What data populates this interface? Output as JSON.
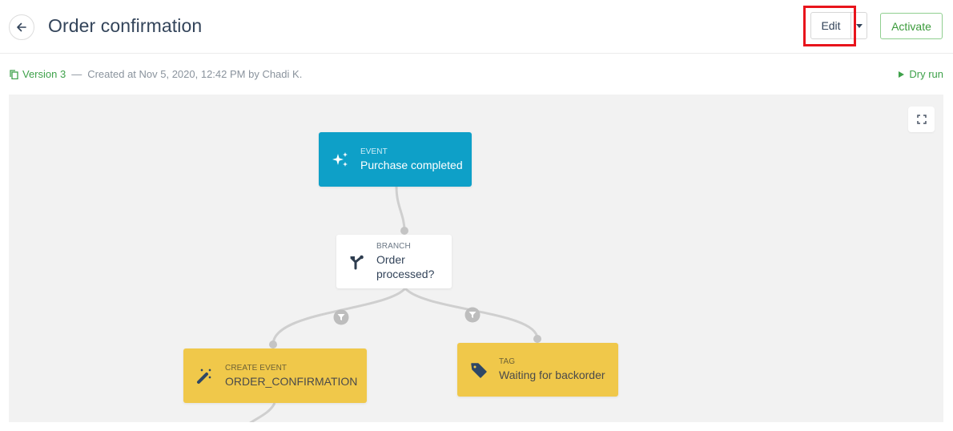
{
  "header": {
    "title": "Order confirmation",
    "back_icon": "arrow-left-icon",
    "edit_label": "Edit",
    "edit_menu_icon": "caret-down-icon",
    "activate_label": "Activate"
  },
  "meta": {
    "version_icon": "copy-icon",
    "version_label": "Version 3",
    "separator": "—",
    "created_text": "Created at Nov 5, 2020, 12:42 PM by Chadi K.",
    "dry_run_icon": "play-icon",
    "dry_run_label": "Dry run"
  },
  "canvas": {
    "fullscreen_icon": "expand-icon",
    "nodes": [
      {
        "id": "event",
        "type": "EVENT",
        "name": "Purchase completed",
        "icon": "sparkles-icon",
        "color": "#0ea0c8"
      },
      {
        "id": "branch",
        "type": "BRANCH",
        "name": "Order processed?",
        "icon": "branch-icon",
        "color": "#ffffff"
      },
      {
        "id": "create",
        "type": "CREATE EVENT",
        "name": "ORDER_CONFIRMATION",
        "icon": "magic-wand-icon",
        "color": "#f0c84a"
      },
      {
        "id": "tag",
        "type": "TAG",
        "name": "Waiting for backorder",
        "icon": "tag-icon",
        "color": "#f0c84a"
      }
    ],
    "filter_icon": "filter-icon"
  },
  "colors": {
    "accent_green": "#3ea14a",
    "highlight_red": "#e8141c",
    "event_blue": "#0ea0c8",
    "action_yellow": "#f0c84a"
  }
}
